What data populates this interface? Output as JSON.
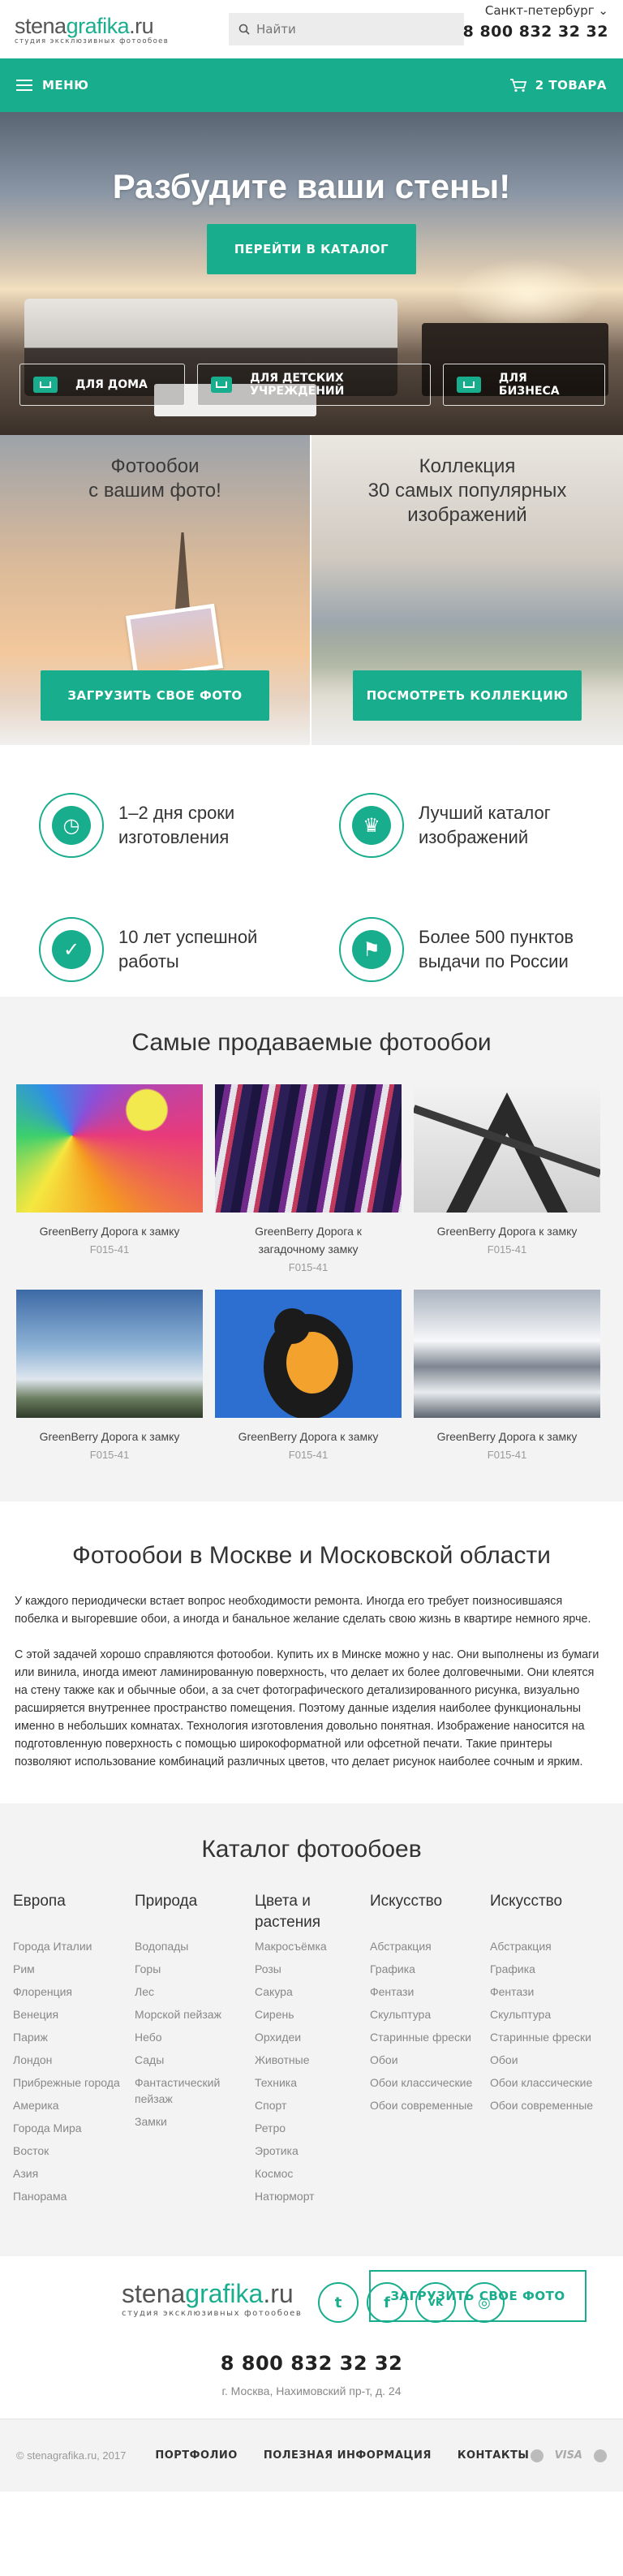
{
  "header": {
    "logo_part1": "stena",
    "logo_part2": "grafika",
    "logo_part3": ".ru",
    "logo_tagline": "студия эксклюзивных фотообоев",
    "search_placeholder": "Найти",
    "city": "Санкт-петербург",
    "phone": "8 800 832 32 32"
  },
  "nav": {
    "menu_label": "МЕНЮ",
    "cart_label": "2 ТОВАРА"
  },
  "hero": {
    "title": "Разбудите ваши стены!",
    "cta": "ПЕРЕЙТИ В КАТАЛОГ",
    "categories": [
      "ДЛЯ ДОМА",
      "ДЛЯ ДЕТСКИХ УЧРЕЖДЕНИЙ",
      "ДЛЯ БИЗНЕСА"
    ]
  },
  "promos": [
    {
      "title_line1": "Фотообои",
      "title_line2": "с вашим фото!",
      "button": "ЗАГРУЗИТЬ СВОЕ ФОТО"
    },
    {
      "title_line1": "Коллекция",
      "title_line2": "30 самых популярных",
      "title_line3": "изображений",
      "button": "ПОСМОТРЕТЬ КОЛЛЕКЦИЮ"
    }
  ],
  "features": [
    {
      "icon": "clock-icon",
      "line1": "1–2 дня сроки",
      "line2": "изготовления"
    },
    {
      "icon": "trophy-icon",
      "line1": "Лучший каталог",
      "line2": "изображений"
    },
    {
      "icon": "check-badge-icon",
      "line1": "10 лет успешной",
      "line2": "работы"
    },
    {
      "icon": "map-pin-icon",
      "line1": "Более 500 пунктов",
      "line2": "выдачи по России"
    }
  ],
  "bestsellers": {
    "title": "Самые продаваемые фотообои",
    "items": [
      {
        "name": "GreenBerry Дорога к замку",
        "sku": "F015-41"
      },
      {
        "name": "GreenBerry Дорога к загадочному замку",
        "sku": "F015-41"
      },
      {
        "name": "GreenBerry Дорога к замку",
        "sku": "F015-41"
      },
      {
        "name": "GreenBerry Дорога к замку",
        "sku": "F015-41"
      },
      {
        "name": "GreenBerry Дорога к замку",
        "sku": "F015-41"
      },
      {
        "name": "GreenBerry Дорога к замку",
        "sku": "F015-41"
      }
    ]
  },
  "seo": {
    "title": "Фотообои в Москве и Московской области",
    "p1": "У каждого периодически встает вопрос необходимости ремонта. Иногда его требует поизносившаяся побелка и выгоревшие обои, а иногда и банальное желание сделать свою жизнь в квартире немного ярче.",
    "p2": "С этой задачей хорошо справляются фотообои. Купить их в Минске можно у нас. Они выполнены из бумаги или винила, иногда имеют ламинированную поверхность, что делает их более долговечными. Они клеятся на стену также как и обычные обои, а за счет фотографического детализированного рисунка, визуально расширяется внутреннее пространство помещения. Поэтому данные изделия наиболее функциональны именно в небольших комнатах. Технология изготовления довольно понятная. Изображение наносится на подготовленную поверхность с помощью широкоформатной или офсетной печати. Такие принтеры позволяют использование комбинаций различных цветов, что делает рисунок наиболее сочным и ярким."
  },
  "catalog": {
    "title": "Каталог фотообоев",
    "columns": [
      {
        "heading": "Европа",
        "items": [
          "Города Италии",
          "Рим",
          "Флоренция",
          "Венеция",
          "Париж",
          "Лондон",
          "Прибрежные города",
          "Америка",
          "Города Мира",
          "Восток",
          "Азия",
          "Панорама"
        ]
      },
      {
        "heading": "Природа",
        "items": [
          "Водопады",
          "Горы",
          "Лес",
          "Морской пейзаж",
          "Небо",
          "Сады",
          "Фантастический пейзаж",
          "Замки"
        ]
      },
      {
        "heading": "Цвета и растения",
        "items": [
          "Макросъёмка",
          "Розы",
          "Сакура",
          "Сирень",
          "Орхидеи",
          "Животные",
          "Техника",
          "Спорт",
          "Ретро",
          "Эротика",
          "Космос",
          "Натюрморт"
        ]
      },
      {
        "heading": "Искусство",
        "items": [
          "Абстракция",
          "Графика",
          "Фентази",
          "Скульптура",
          "Старинные фрески",
          "Обои",
          "Обои классические",
          "Обои современные"
        ]
      },
      {
        "heading": "Искусство",
        "items": [
          "Абстракция",
          "Графика",
          "Фентази",
          "Скульптура",
          "Старинные фрески",
          "Обои",
          "Обои классические",
          "Обои современные"
        ]
      }
    ],
    "upload_button": "ЗАГРУЗИТЬ СВОЕ ФОТО"
  },
  "footer": {
    "phone": "8 800 832 32 32",
    "address": "г. Москва, Нахимовский пр-т, д. 24",
    "social": [
      "twitter-icon",
      "facebook-icon",
      "vk-icon",
      "instagram-icon"
    ],
    "copyright": "© stenagrafika.ru, 2017",
    "links": [
      "ПОРТФОЛИО",
      "ПОЛЕЗНАЯ ИНФОРМАЦИЯ",
      "КОНТАКТЫ"
    ],
    "payments": [
      "mastercard-icon",
      "visa-icon",
      "maestro-icon"
    ],
    "payment_labels": {
      "visa": "VISA"
    }
  },
  "colors": {
    "accent": "#18ad8d"
  }
}
